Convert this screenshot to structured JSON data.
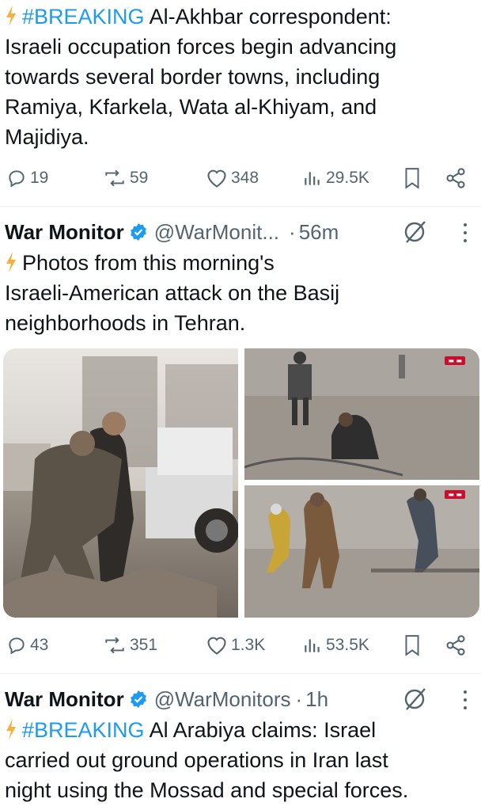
{
  "post1": {
    "hashtag": "#BREAKING",
    "line1_rest": " Al-Akhbar correspondent:",
    "line2": "Israeli occupation forces begin advancing",
    "line3": "towards several border towns, including",
    "line4": "Ramiya, Kfarkela, Wata al-Khiyam, and",
    "line5": "Majidiya.",
    "replies": "19",
    "reposts": "59",
    "likes": "348",
    "views": "29.5K"
  },
  "post2": {
    "name": "War Monitor",
    "handle": "@WarMonit...",
    "separator": "·",
    "time": "56m",
    "line1": "Photos from this morning's",
    "line2": "Israeli-American attack on the Basij",
    "line3": "neighborhoods in Tehran.",
    "replies": "43",
    "reposts": "351",
    "likes": "1.3K",
    "views": "53.5K"
  },
  "post3": {
    "name": "War Monitor",
    "handle": "@WarMonitors",
    "separator": "·",
    "time": "1h",
    "hashtag": "#BREAKING",
    "line1_rest": " Al Arabiya claims: Israel",
    "line2": "carried out ground operations in Iran last",
    "line3": "night using the Mossad and special forces."
  },
  "icons": {
    "bolt": "lightning-bolt-icon",
    "reply": "reply-icon",
    "repost": "repost-icon",
    "like": "heart-icon",
    "views": "views-icon",
    "bookmark": "bookmark-icon",
    "share": "share-icon",
    "verified": "verified-badge-icon",
    "grok": "grok-icon",
    "more": "more-dots-icon"
  },
  "colors": {
    "link": "#1d9bf0",
    "text": "#0f1419",
    "secondary": "#536471",
    "bolt": "#f4b13d",
    "verified": "#1d9bf0"
  }
}
